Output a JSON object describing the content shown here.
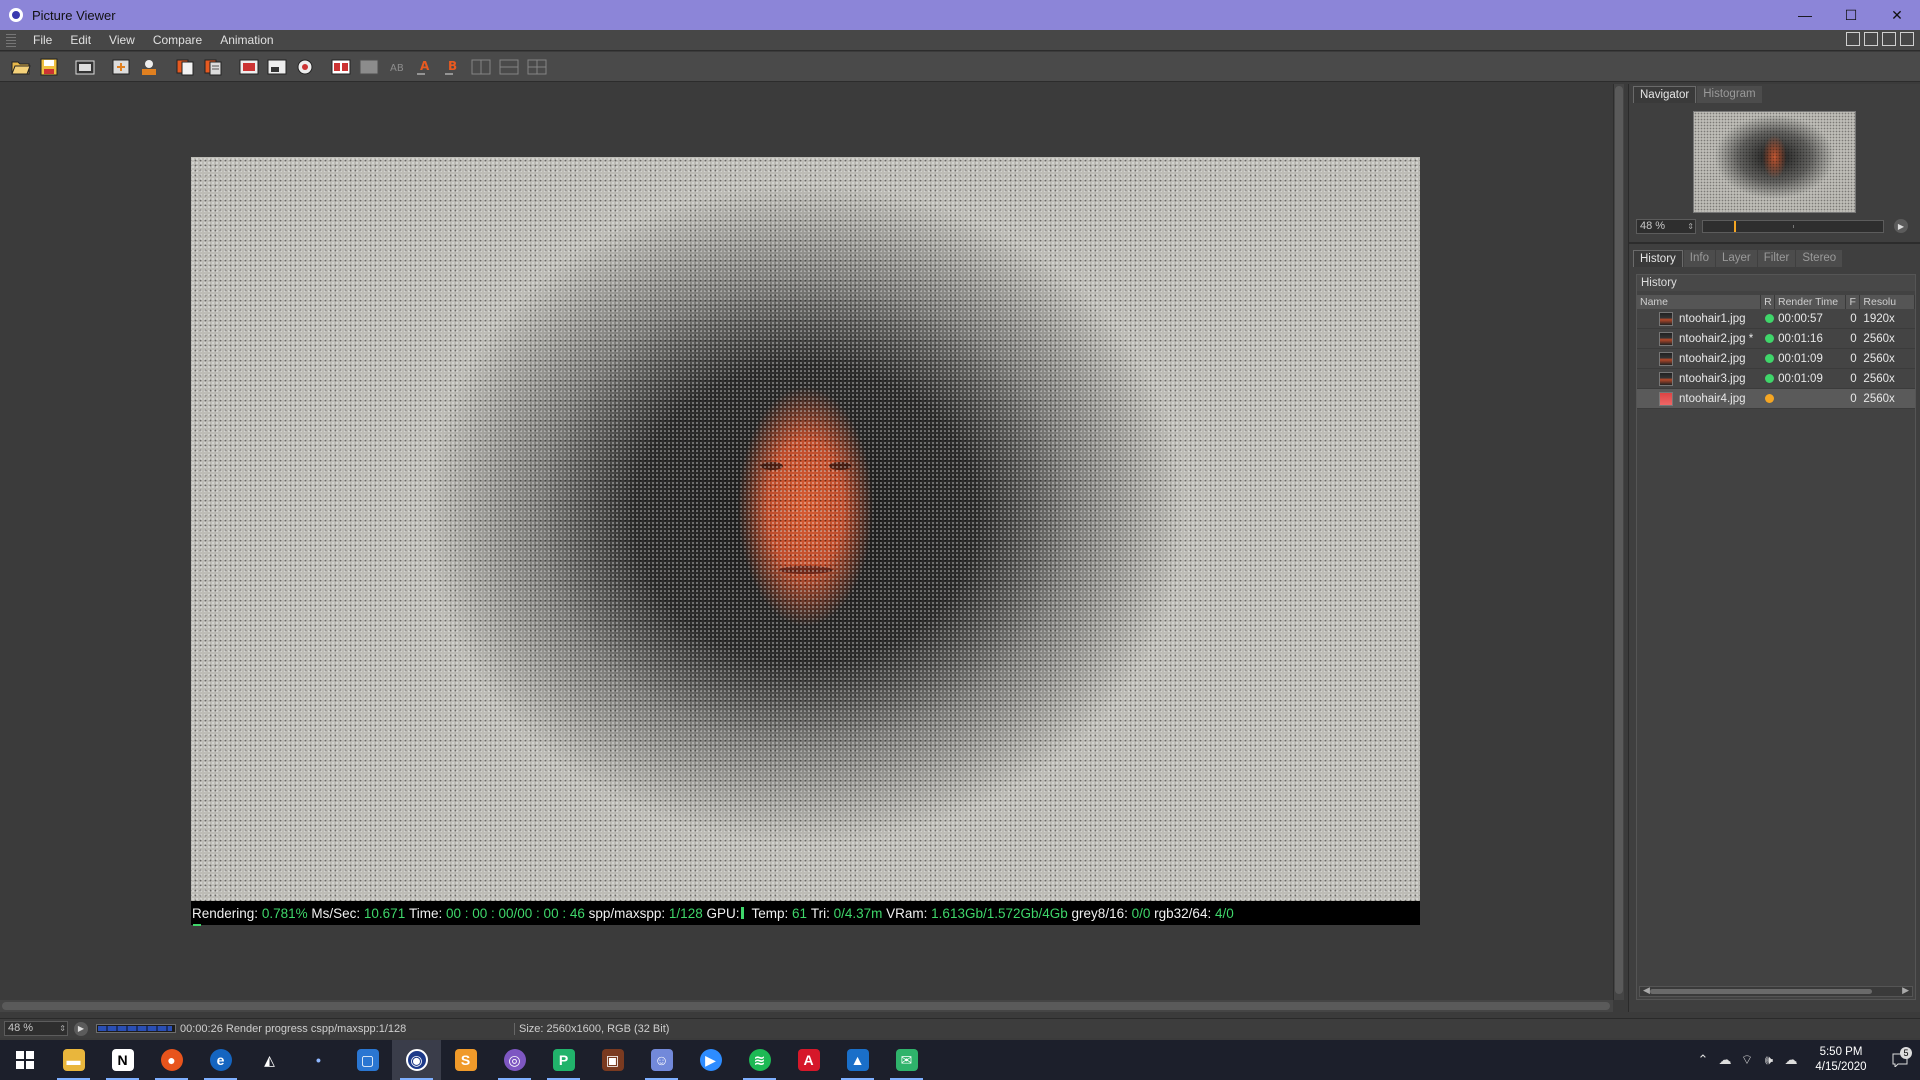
{
  "window": {
    "title": "Picture Viewer",
    "controls": {
      "minimize": "—",
      "maximize": "☐",
      "close": "✕"
    }
  },
  "menu": [
    "File",
    "Edit",
    "View",
    "Compare",
    "Animation"
  ],
  "toolbar": {
    "icons": [
      "open-icon",
      "save-icon",
      "render-region-icon",
      "export-icon",
      "user-icon",
      "copy-icon",
      "paste-icon",
      "ab-compare-icon",
      "ab-swap-icon",
      "ab-mark-icon",
      "a-icon",
      "b-icon",
      "split-icon",
      "layout-icon",
      "grid-icon"
    ]
  },
  "render_status": {
    "rendering_label": "Rendering:",
    "rendering_value": "0.781%",
    "ms_label": "Ms/Sec:",
    "ms_value": "10.671",
    "time_label": "Time:",
    "time_value": "00 : 00 : 00/00 : 00 : 46",
    "spp_label": "spp/maxspp:",
    "spp_value": "1/128",
    "gpu_label": "GPU:",
    "temp_label": "Temp:",
    "temp_value": "61",
    "tri_label": "Tri:",
    "tri_value": "0/4.37m",
    "vram_label": "VRam:",
    "vram_value": "1.613Gb/1.572Gb/4Gb",
    "grey_label": "grey8/16:",
    "grey_value": "0/0",
    "rgb_label": "rgb32/64:",
    "rgb_value": "4/0"
  },
  "navigator": {
    "tabs": [
      "Navigator",
      "Histogram"
    ],
    "zoom": "48 %",
    "zoom_slider_fraction": 0.17
  },
  "history_panel": {
    "tabs": [
      "History",
      "Info",
      "Layer",
      "Filter",
      "Stereo"
    ],
    "title": "History",
    "columns": [
      "Name",
      "R",
      "Render Time",
      "F",
      "Resolu"
    ],
    "rows": [
      {
        "name": "ntoohair1.jpg",
        "status": "green",
        "time": "00:00:57",
        "f": "0",
        "res": "1920x"
      },
      {
        "name": "ntoohair2.jpg *",
        "status": "green",
        "time": "00:01:16",
        "f": "0",
        "res": "2560x"
      },
      {
        "name": "ntoohair2.jpg",
        "status": "green",
        "time": "00:01:09",
        "f": "0",
        "res": "2560x"
      },
      {
        "name": "ntoohair3.jpg",
        "status": "green",
        "time": "00:01:09",
        "f": "0",
        "res": "2560x"
      },
      {
        "name": "ntoohair4.jpg",
        "status": "orange",
        "time": "",
        "f": "0",
        "res": "2560x"
      }
    ]
  },
  "statusbar": {
    "zoom": "48 %",
    "message": "00:00:26 Render progress  cspp/maxspp:1/128",
    "size": "Size: 2560x1600, RGB (32 Bit)",
    "progress_fraction": 0.95
  },
  "taskbar": {
    "apps": [
      "windows-start-icon",
      "file-explorer-icon",
      "notion-icon",
      "firefox-icon",
      "edge-icon",
      "unity-icon",
      "app-icon",
      "store-icon",
      "cinema4d-icon",
      "sublime-icon",
      "app-purple-icon",
      "pycharm-icon",
      "app-orange-icon",
      "discord-icon",
      "zoom-icon",
      "spotify-icon",
      "acrobat-icon",
      "photos-icon",
      "mail-icon"
    ],
    "time": "5:50 PM",
    "date": "4/15/2020",
    "notification_count": "5"
  },
  "colors": {
    "titlebar": "#8c85d8",
    "status_green": "#3fd66a",
    "status_orange": "#f5a623",
    "taskbar": "#1c1f2b"
  }
}
